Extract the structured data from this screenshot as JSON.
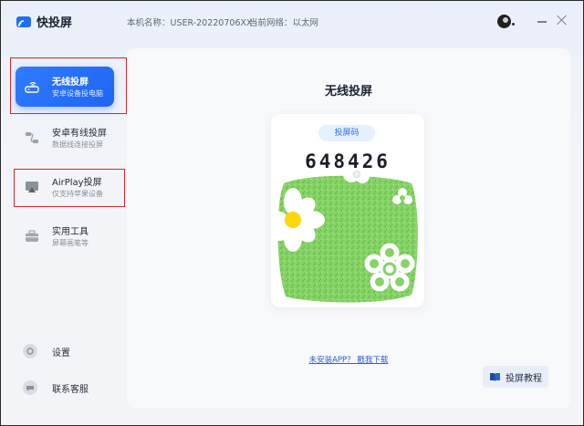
{
  "app": {
    "name": "快投屏"
  },
  "header": {
    "machine_name": "本机名称：USER-20220706XX",
    "network": "当前网络：以太网"
  },
  "sidebar": {
    "items": [
      {
        "title": "无线投屏",
        "subtitle": "安卓设备投电脑",
        "active": true
      },
      {
        "title": "安卓有线投屏",
        "subtitle": "数据线连接投屏",
        "active": false
      },
      {
        "title": "AirPlay投屏",
        "subtitle": "仅支持苹果设备",
        "active": false
      },
      {
        "title": "实用工具",
        "subtitle": "屏幕画笔等",
        "active": false
      }
    ],
    "bottom": [
      {
        "label": "设置"
      },
      {
        "label": "联系客服"
      }
    ]
  },
  "main": {
    "title": "无线投屏",
    "code_label": "投屏码",
    "code": "648426",
    "download_link": "未安装APP？ 戳我下载",
    "tutorial_label": "投屏教程"
  },
  "colors": {
    "accent": "#1f64f2",
    "annotation_red": "#d9262c",
    "qr_green": "#7fcf5a"
  },
  "icons": {
    "logo": "cast-logo-icon",
    "wireless": "router-icon",
    "wired": "usb-cable-icon",
    "airplay": "airplay-icon",
    "tools": "toolbox-icon",
    "settings": "gear-icon",
    "support": "chat-icon",
    "tutorial": "book-icon"
  }
}
